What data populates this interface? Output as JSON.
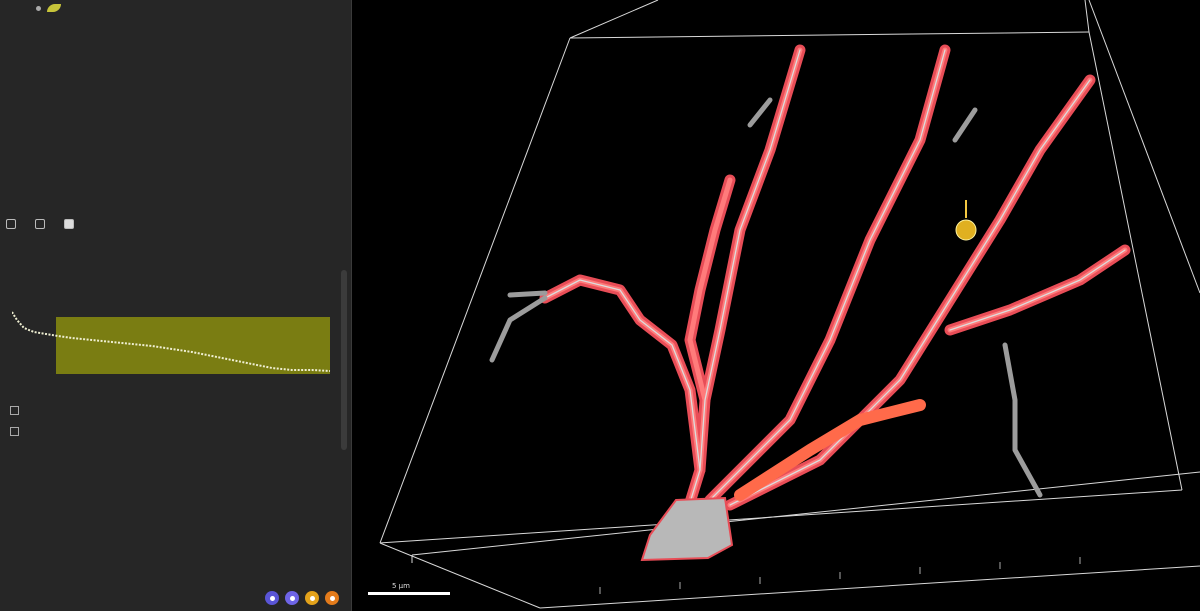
{
  "panel": {
    "top_item": "",
    "tabs": [
      {
        "label": "",
        "active": false
      },
      {
        "label": "",
        "active": false
      },
      {
        "label": "",
        "active": true
      }
    ],
    "section_title": "",
    "sub_label": "",
    "channel_label": "",
    "filter_label": "",
    "option_1": "",
    "option_2": "",
    "histogram": {
      "fill_color": "#7a7d12",
      "curve_color": "#e9e9c8"
    },
    "color_buttons": [
      "#5a55d6",
      "#6e64e6",
      "#e3a21b",
      "#e37b1b"
    ]
  },
  "viewport": {
    "scale_label": "5 µm",
    "dendrite_color": "#ff5757",
    "surface_color": "#b8b8b8",
    "marker_color": "#e0b020"
  }
}
